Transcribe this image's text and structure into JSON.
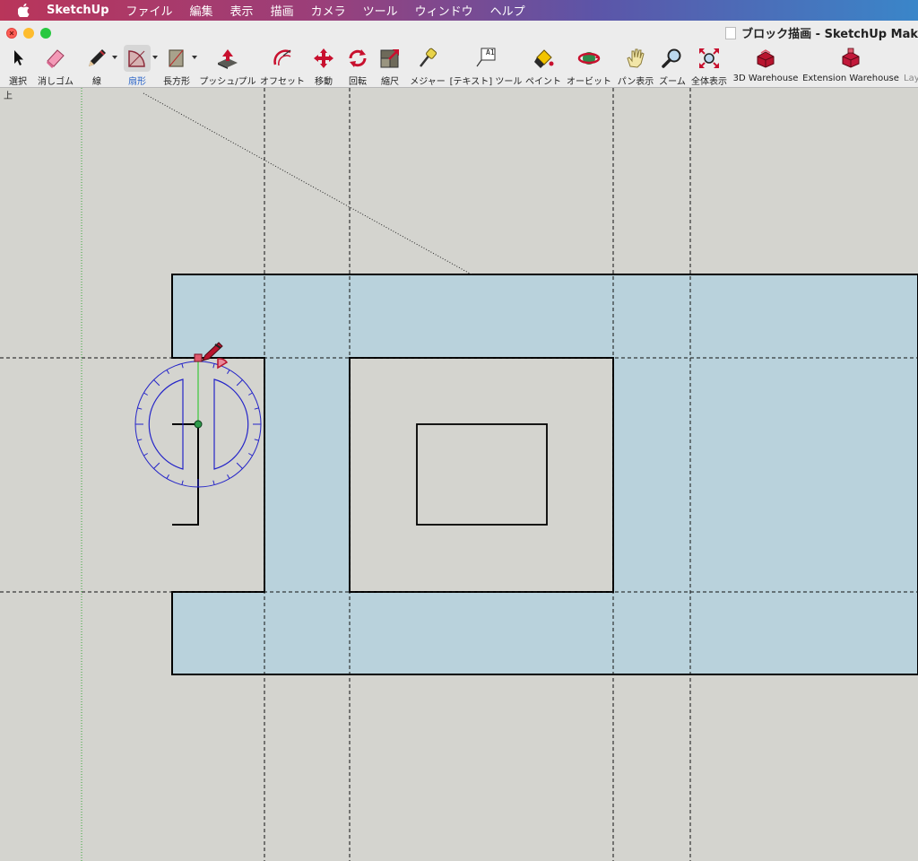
{
  "menubar": {
    "items": [
      "SketchUp",
      "ファイル",
      "編集",
      "表示",
      "描画",
      "カメラ",
      "ツール",
      "ウィンドウ",
      "ヘルプ"
    ]
  },
  "window": {
    "title": "ブロック描画 - SketchUp Mak"
  },
  "toolbar": {
    "tools": [
      {
        "label": "選択",
        "icon": "arrow-cursor-icon"
      },
      {
        "label": "消しゴム",
        "icon": "eraser-icon"
      },
      {
        "label": "線",
        "icon": "pencil-icon"
      },
      {
        "label": "扇形",
        "icon": "pie-arc-icon"
      },
      {
        "label": "長方形",
        "icon": "rectangle-icon"
      },
      {
        "label": "プッシュ/プル",
        "icon": "push-pull-icon"
      },
      {
        "label": "オフセット",
        "icon": "offset-icon"
      },
      {
        "label": "移動",
        "icon": "move-icon"
      },
      {
        "label": "回転",
        "icon": "rotate-icon"
      },
      {
        "label": "縮尺",
        "icon": "scale-icon"
      },
      {
        "label": "メジャー",
        "icon": "tape-measure-icon"
      },
      {
        "label": "[テキスト] ツール",
        "icon": "text-tool-icon"
      },
      {
        "label": "ペイント",
        "icon": "paint-bucket-icon"
      },
      {
        "label": "オービット",
        "icon": "orbit-icon"
      },
      {
        "label": "パン表示",
        "icon": "pan-hand-icon"
      },
      {
        "label": "ズーム",
        "icon": "zoom-icon"
      },
      {
        "label": "全体表示",
        "icon": "zoom-extents-icon"
      },
      {
        "label": "3D Warehouse",
        "icon": "warehouse-icon"
      },
      {
        "label": "Extension Warehouse",
        "icon": "extension-warehouse-icon"
      },
      {
        "label": "Lay",
        "icon": "layout-icon"
      }
    ],
    "text_tool_glyph": "A1"
  },
  "viewport": {
    "view_label": "上"
  },
  "colors": {
    "face": "#b9d2dc",
    "background": "#d4d4cf",
    "edges": "#000000",
    "protractor": "#2424c8",
    "active_label": "#2a64c8"
  }
}
